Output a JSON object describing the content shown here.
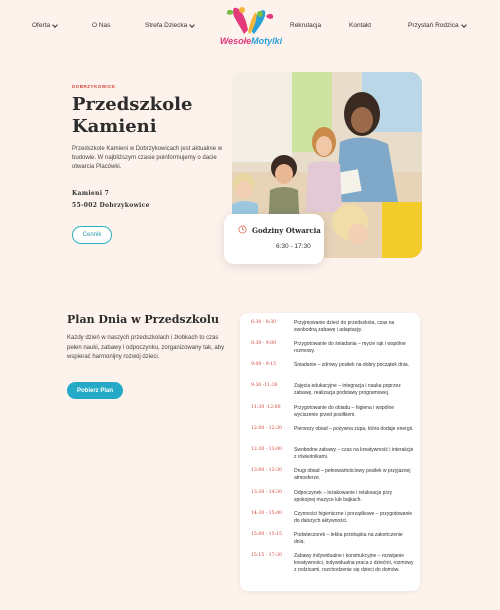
{
  "nav": {
    "items": [
      {
        "label": "Oferta",
        "dropdown": true
      },
      {
        "label": "O Nas",
        "dropdown": false
      },
      {
        "label": "Strefa Dziecka",
        "dropdown": true
      },
      {
        "label": "Rekrutacja",
        "dropdown": false
      },
      {
        "label": "Kontakt",
        "dropdown": false
      },
      {
        "label": "Przystań Rodzica",
        "dropdown": true
      }
    ],
    "logo": {
      "part1": "Wesołe",
      "part2": "Motylki"
    }
  },
  "hero": {
    "eyebrow": "DOBRZYKOWICE",
    "title": "Przedszkole Kamieni",
    "description": "Przedszkole Kamieni w Dobrzykowicach jest aktualnie w budowie. W najbliższym czasie poinformujemy o dacie otwarcia Placówki.",
    "address_line1": "Kamieni 7",
    "address_line2": "55-002 Dobrzykowice",
    "button": "Cennik",
    "hours_title": "Godziny Otwarcia",
    "hours_value": "6:30 - 17:30"
  },
  "plan": {
    "title": "Plan Dnia w Przedszkolu",
    "description": "Każdy dzień w naszych przedszkolach i żłobkach to czas pełen nauki, zabawy i odpoczynku, zorganizowany tak, aby wspierać harmonijny rozwój dzieci.",
    "button": "Pobierz Plan",
    "schedule": [
      {
        "time": "6:30 - 8:30",
        "text": "Przyjmowanie dzieci do przedszkola, czas na swobodną zabawę i adaptację."
      },
      {
        "time": "8:30 - 9:00",
        "text": "Przygotowanie do śniadania – mycie rąk i wspólne rozmowy."
      },
      {
        "time": "9:00 - 9:15",
        "text": "Śniadanie – zdrowy posiłek na dobry początek dnia."
      },
      {
        "time": "9:30 -11:30",
        "text": "Zajęcia edukacyjne – integracja i nauka poprzez zabawę, realizacja podstawy programowej."
      },
      {
        "time": "11:30 -12:00",
        "text": "Przygotowanie do obiadu – higiena i wspólne wyciszenie przed posiłkiem."
      },
      {
        "time": "12:00 - 12:30",
        "text": "Pierwszy obiad – pożywna zupa, która dodaje energii."
      },
      {
        "time": "12:30 - 13:00",
        "text": "Swobodne zabawy – czas na kreatywność i interakcje z rówieśnikami."
      },
      {
        "time": "13:00 - 13:30",
        "text": "Drugi obiad – pełnowartościowy posiłek w przyjaznej atmosferze."
      },
      {
        "time": "13:30 - 14:30",
        "text": "Odpoczynek – leżakowanie i relaksacja przy spokojnej muzyce lub bajkach."
      },
      {
        "time": "14:30 - 15:00",
        "text": "Czynności higieniczne i porządkowe – przygotowanie do dalszych aktywności."
      },
      {
        "time": "15:00 - 15:15",
        "text": "Podwieczorek – lekka przekąska na zakończenie dnia."
      },
      {
        "time": "15:15 - 17:30",
        "text": "Zabawy indywidualne i konstrukcyjne – rozwijanie kreatywności, indywidualna praca z dziećmi, rozmowy z rodzicami, rozchodzenie się dzieci do domów."
      }
    ]
  },
  "colors": {
    "accent": "#24a9c6",
    "eyebrow": "#d0453a",
    "background": "#fdf2ec"
  }
}
